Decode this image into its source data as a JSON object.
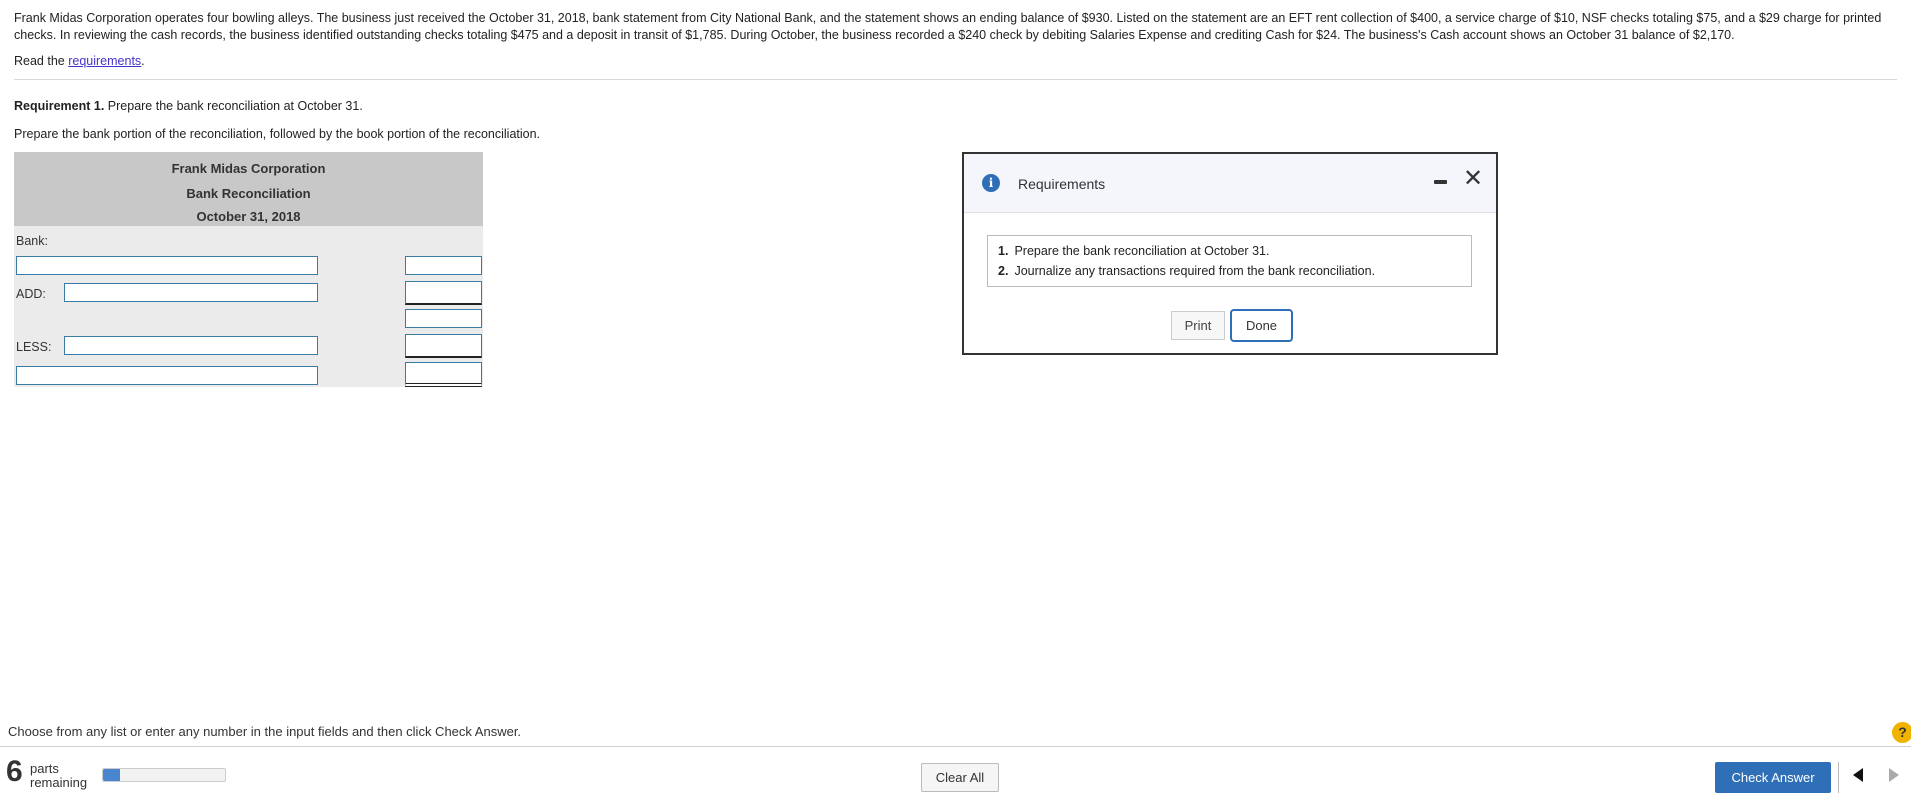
{
  "problem": {
    "text": "Frank Midas Corporation operates four bowling alleys. The business just received the October 31, 2018, bank statement from City National Bank, and the statement shows an ending balance of $930. Listed on the statement are an EFT rent collection of $400, a service charge of $10, NSF checks totaling $75, and a $29 charge for printed checks. In reviewing the cash records, the business identified outstanding checks totaling $475 and a deposit in transit of $1,785. During October, the business recorded a $240 check by debiting Salaries Expense and crediting Cash for $24. The business's Cash account shows an October 31 balance of $2,170.",
    "read_prefix": "Read the ",
    "read_link": "requirements",
    "read_suffix": "."
  },
  "requirement1": {
    "label": "Requirement 1.",
    "text": " Prepare the bank reconciliation at October 31.",
    "instruction": "Prepare the bank portion of the reconciliation, followed by the book portion of the reconciliation."
  },
  "recon": {
    "company": "Frank Midas Corporation",
    "title": "Bank Reconciliation",
    "date": "October 31, 2018",
    "bank_label": "Bank:",
    "add_label": "ADD:",
    "less_label": "LESS:",
    "inputs": {
      "bank_desc": "",
      "bank_amt": "",
      "add_desc": "",
      "add_amt": "",
      "add_total": "",
      "less_desc": "",
      "less_amt": "",
      "final_desc": "",
      "final_amt": ""
    }
  },
  "modal": {
    "title": "Requirements",
    "items": [
      {
        "num": "1.",
        "text": "Prepare the bank reconciliation at October 31."
      },
      {
        "num": "2.",
        "text": "Journalize any transactions required from the bank reconciliation."
      }
    ],
    "print_label": "Print",
    "done_label": "Done"
  },
  "footer": {
    "instruction": "Choose from any list or enter any number in the input fields and then click Check Answer.",
    "parts_count": "6",
    "parts_word": "parts",
    "remaining_word": "remaining",
    "progress_fraction": 0.14,
    "clear_label": "Clear All",
    "check_label": "Check Answer",
    "help_glyph": "?"
  },
  "colors": {
    "accent": "#2f6fb8",
    "table_header": "#c8c8c8",
    "table_body": "#ebebeb",
    "input_border": "#3a7ca5"
  }
}
